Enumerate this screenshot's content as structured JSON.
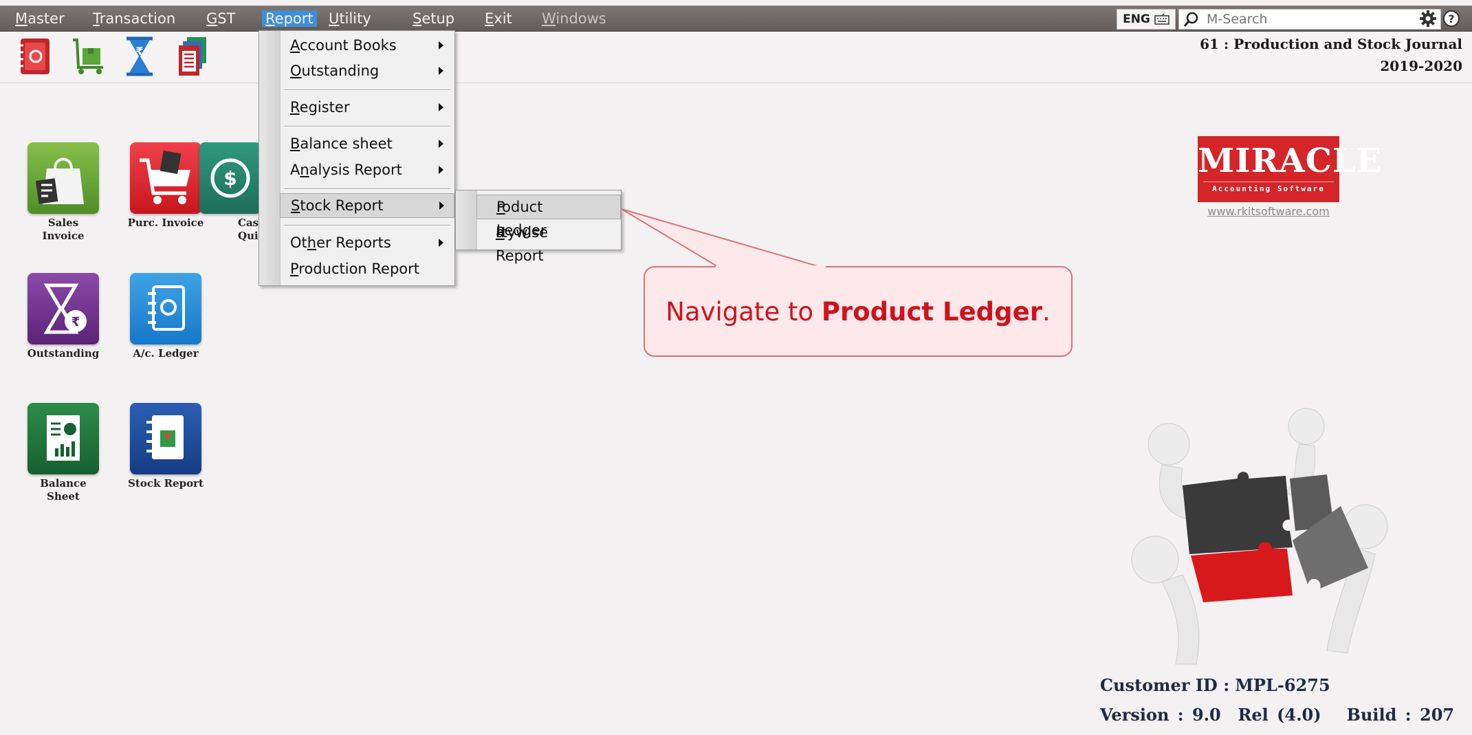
{
  "menubar": {
    "items": [
      {
        "label": "Master",
        "underline": "M",
        "rest": "aster"
      },
      {
        "label": "Transaction",
        "underline": "T",
        "rest": "ransaction"
      },
      {
        "label": "GST",
        "underline": "G",
        "rest": "ST"
      },
      {
        "label": "Report",
        "underline": "R",
        "rest": "eport"
      },
      {
        "label": "Utility",
        "underline": "U",
        "rest": "tility"
      },
      {
        "label": "Setup",
        "underline": "S",
        "rest": "etup"
      },
      {
        "label": "Exit",
        "underline": "E",
        "rest": "xit"
      },
      {
        "label": "Windows",
        "underline": "W",
        "rest": "indows"
      }
    ],
    "language": "ENG",
    "search_placeholder": "M-Search"
  },
  "header": {
    "company": "61 : Production and Stock Journal",
    "year": "2019-2020"
  },
  "tiles": [
    {
      "label": "Sales Invoice",
      "line1": "Sales",
      "line2": "Invoice"
    },
    {
      "label": "Purc. Invoice",
      "line1": "Purc. Invoice",
      "line2": ""
    },
    {
      "label": "Cash Quick",
      "line1": "Cas",
      "line2": "Quic"
    },
    {
      "label": "Outstanding",
      "line1": "Outstanding",
      "line2": ""
    },
    {
      "label": "A/c. Ledger",
      "line1": "A/c. Ledger",
      "line2": ""
    },
    {
      "label": "Balance Sheet",
      "line1": "Balance",
      "line2": "Sheet"
    },
    {
      "label": "Stock Report",
      "line1": "Stock Report",
      "line2": ""
    }
  ],
  "report_menu": {
    "items": [
      {
        "pre": "",
        "u": "A",
        "post": "ccount Books"
      },
      {
        "pre": "",
        "u": "O",
        "post": "utstanding"
      },
      {
        "pre": "",
        "u": "R",
        "post": "egister"
      },
      {
        "pre": "",
        "u": "B",
        "post": "alance sheet"
      },
      {
        "pre": "A",
        "u": "n",
        "post": "alysis Report"
      },
      {
        "pre": "",
        "u": "S",
        "post": "tock Report"
      },
      {
        "pre": "Ot",
        "u": "h",
        "post": "er Reports"
      },
      {
        "pre": "",
        "u": "P",
        "post": "roduction Report"
      }
    ]
  },
  "stock_submenu": {
    "items": [
      {
        "pre": "",
        "u": "P",
        "post": "roduct Ledger"
      },
      {
        "pre": "P",
        "u": "a",
        "post": "rtywise Report"
      }
    ]
  },
  "callout": {
    "prefix": "Navigate to ",
    "bold": "Product Ledger",
    "suffix": "."
  },
  "branding": {
    "logo_text": "MIRACLE",
    "logo_tagline": "Accounting Software",
    "url": "www.rkitsoftware.com"
  },
  "footer": {
    "customer_id": "Customer ID : MPL-6275",
    "version": "Version : 9.0  Rel (4.0)   Build : 207"
  },
  "colors": {
    "menubar": "#6e6866",
    "menu_active": "#3f8fd6",
    "callout_text": "#d0121e",
    "logo_red": "#d42529"
  }
}
